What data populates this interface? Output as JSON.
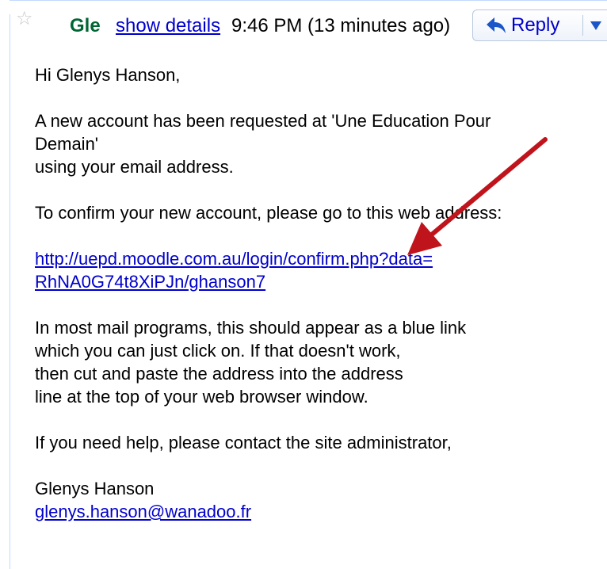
{
  "header": {
    "sender": "Gle",
    "show_details": "show details",
    "timestamp": "9:46 PM (13 minutes ago)",
    "reply_label": "Reply",
    "star_glyph": "☆"
  },
  "body": {
    "greeting": "Hi Glenys Hanson,",
    "para1": {
      "line1": "A new account has been requested at 'Une Education Pour",
      "line2": "Demain'",
      "line3": "using your email address."
    },
    "para2": "To confirm your new account, please go to this web address:",
    "link": {
      "line1": "http://uepd.moodle.com.au/login/confirm.php?data=",
      "line2": "RhNA0G74t8XiPJn/ghanson7"
    },
    "para3": {
      "line1": "In most mail programs, this should appear as a blue link",
      "line2": "which you can just click on. If that doesn't work,",
      "line3": "then cut and paste the address into the address",
      "line4": "line at the top of your web browser window."
    },
    "para4": "If you need help, please contact the site administrator,",
    "signature": {
      "name": "Glenys Hanson",
      "email": "glenys.hanson@wanadoo.fr"
    }
  },
  "colors": {
    "sender": "#006633",
    "link": "#0000cc",
    "arrow": "#c0141c",
    "border": "#c3d9ff"
  },
  "icons": {
    "star": "star-icon",
    "reply": "reply-arrow-icon",
    "dropdown": "triangle-down-icon",
    "annotation": "red-arrow-annotation"
  }
}
